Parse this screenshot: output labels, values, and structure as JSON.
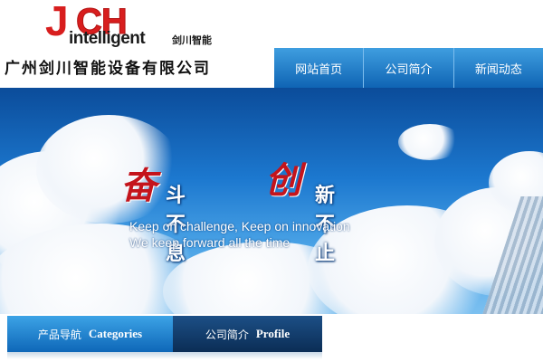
{
  "header": {
    "logo": {
      "big_letters": "JCH",
      "j": "J",
      "ch": "CH",
      "wordmark": "intelligent",
      "wordmark_cn": "剑川智能"
    },
    "company_name": "广州剑川智能设备有限公司"
  },
  "nav": {
    "items": [
      {
        "label": "网站首页"
      },
      {
        "label": "公司简介"
      },
      {
        "label": "新闻动态"
      }
    ]
  },
  "banner": {
    "slogan": {
      "char1": "奋",
      "phrase1": "斗不息",
      "char2": "创",
      "phrase2": "新不止"
    },
    "english_line1": "Keep on challenge, Keep on innovation",
    "english_line2": "We keep forward all the time"
  },
  "tabs": {
    "categories": {
      "cn": "产品导航",
      "en": "Categories"
    },
    "profile": {
      "cn": "公司简介",
      "en": "Profile"
    }
  },
  "colors": {
    "brand_red": "#d81e1e",
    "nav_blue": "#1a74c4",
    "profile_tab": "#123d6c"
  }
}
